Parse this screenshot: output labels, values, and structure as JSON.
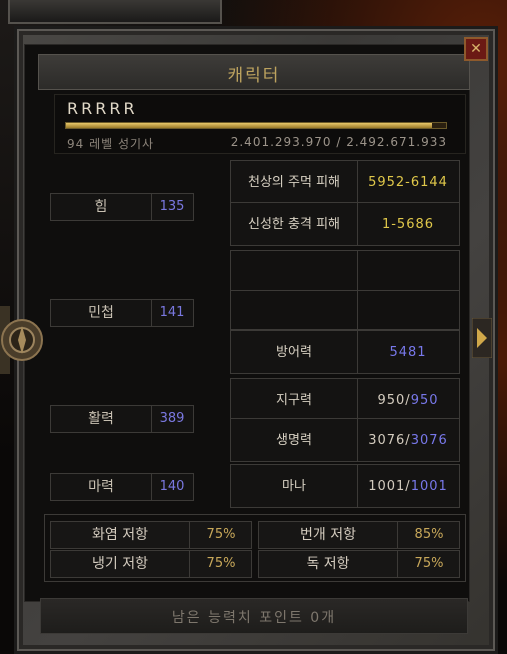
{
  "window": {
    "title": "캐릭터",
    "close_label": "✕"
  },
  "character": {
    "name": "RRRRR",
    "level_class": "94 레벨 성기사",
    "experience": "2.401.293.970 / 2.492.671.933",
    "exp_progress": 0.963
  },
  "stats": [
    {
      "label": "힘",
      "value": "135"
    },
    {
      "label": "민첩",
      "value": "141"
    },
    {
      "label": "활력",
      "value": "389"
    },
    {
      "label": "마력",
      "value": "140"
    }
  ],
  "right": {
    "holy_curse": {
      "label": "천상의 주먹 피해",
      "value": "5952-6144"
    },
    "holy_shock": {
      "label": "신성한 충격 피해",
      "value": "1-5686"
    },
    "defense": {
      "label": "방어력",
      "value": "5481"
    },
    "stamina": {
      "label": "지구력",
      "cur": "950",
      "sep": "/",
      "max": "950"
    },
    "life": {
      "label": "생명력",
      "cur": "3076",
      "sep": "/",
      "max": "3076"
    },
    "mana": {
      "label": "마나",
      "cur": "1001",
      "sep": "/",
      "max": "1001"
    }
  },
  "resistances": [
    {
      "label": "화염 저항",
      "value": "75%"
    },
    {
      "label": "번개 저항",
      "value": "85%"
    },
    {
      "label": "냉기 저항",
      "value": "75%"
    },
    {
      "label": "독 저항",
      "value": "75%"
    }
  ],
  "footer": {
    "points_text": "남은 능력치 포인트 0개"
  },
  "colors": {
    "gold": "#e0c84a",
    "blue": "#7878ea",
    "title": "#bda35f"
  }
}
